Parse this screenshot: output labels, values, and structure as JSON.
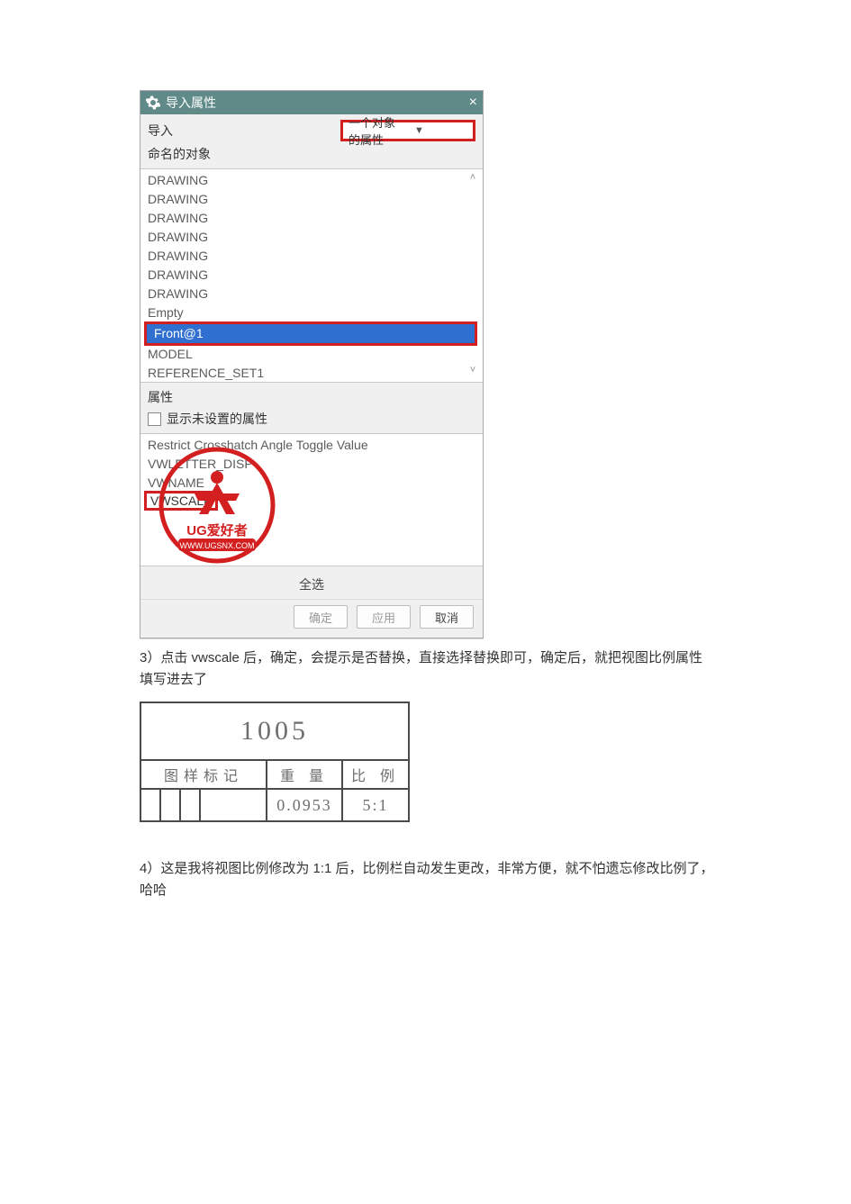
{
  "dialog": {
    "title": "导入属性",
    "close_glyph": "×",
    "import_label": "导入",
    "import_value": "一个对象的属性",
    "named_objects_label": "命名的对象",
    "objects": [
      "DRAWING",
      "DRAWING",
      "DRAWING",
      "DRAWING",
      "DRAWING",
      "DRAWING",
      "DRAWING",
      "Empty",
      "Front@1",
      "MODEL",
      "REFERENCE_SET1"
    ],
    "selected_index": 8,
    "props_label": "属性",
    "show_unset_label": "显示未设置的属性",
    "prop_items": [
      "Restrict Crosshatch Angle Toggle Value",
      "VWLETTER_DISP",
      "VWNAME",
      "VWSCALE"
    ],
    "prop_highlight_index": 3,
    "select_all": "全选",
    "ok": "确定",
    "apply": "应用",
    "cancel": "取消"
  },
  "watermark": {
    "line1": "UG爱好者",
    "line2": "WWW.UGSNX.COM"
  },
  "para3": "3）点击 vwscale 后，确定，会提示是否替换，直接选择替换即可，确定后，就把视图比例属性填写进去了",
  "table": {
    "top_value": "1005",
    "h1": "图样标记",
    "h2": "重 量",
    "h3": "比 例",
    "weight": "0.0953",
    "scale": "5:1"
  },
  "para4": "4）这是我将视图比例修改为 1:1 后，比例栏自动发生更改，非常方便，就不怕遗忘修改比例了，哈哈"
}
